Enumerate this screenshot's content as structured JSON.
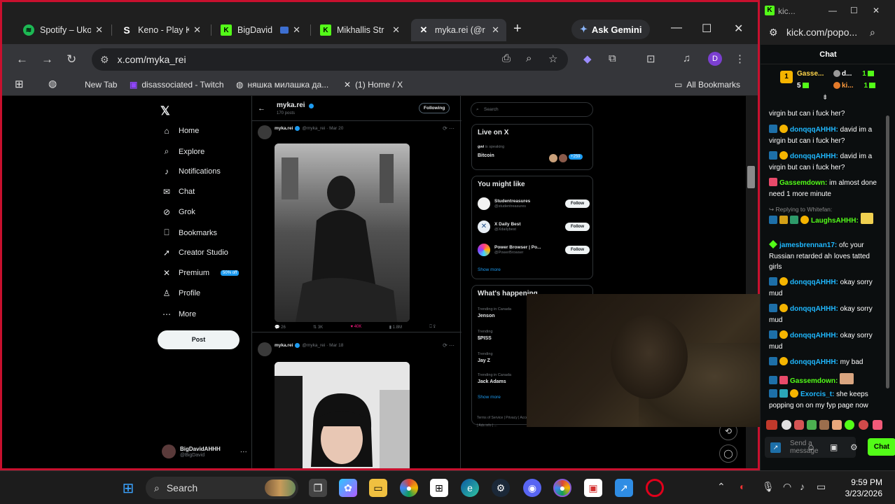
{
  "browser": {
    "tabs": [
      {
        "label": "Spotify – Uko",
        "icon": "spotify-icon",
        "color": "#1db954"
      },
      {
        "label": "Keno - Play K",
        "icon": "stake-icon",
        "color": "#ffffff"
      },
      {
        "label": "BigDavid",
        "icon": "kick-icon",
        "color": "#53fc18"
      },
      {
        "label": "Mikhallis Str",
        "icon": "kick-icon",
        "color": "#53fc18"
      },
      {
        "label": "myka.rei (@r",
        "icon": "x-icon",
        "color": "#ffffff"
      }
    ],
    "new_tab": "+",
    "gemini_label": "Ask Gemini",
    "url": "x.com/myka_rei",
    "profile_letter": "D",
    "bookmarks": [
      {
        "label": "New Tab"
      },
      {
        "label": "disassociated - Twitch"
      },
      {
        "label": "няшка милашка да..."
      },
      {
        "label": "(1) Home / X"
      }
    ],
    "all_bookmarks": "All Bookmarks"
  },
  "x": {
    "logo": "𝕏",
    "nav": [
      {
        "label": "Home",
        "icon": "home-icon",
        "glyph": "⌂"
      },
      {
        "label": "Explore",
        "icon": "search-icon",
        "glyph": "⌕"
      },
      {
        "label": "Notifications",
        "icon": "bell-icon",
        "glyph": "🔔"
      },
      {
        "label": "Chat",
        "icon": "mail-icon",
        "glyph": "✉"
      },
      {
        "label": "Grok",
        "icon": "grok-icon",
        "glyph": "⊘"
      },
      {
        "label": "Bookmarks",
        "icon": "bookmark-icon",
        "glyph": "⎕"
      },
      {
        "label": "Creator Studio",
        "icon": "rocket-icon",
        "glyph": "➚"
      },
      {
        "label": "Premium",
        "icon": "x-premium-icon",
        "glyph": "✕"
      },
      {
        "label": "Profile",
        "icon": "person-icon",
        "glyph": "♙"
      },
      {
        "label": "More",
        "icon": "more-icon",
        "glyph": "⋯"
      }
    ],
    "premium_badge": "50% off",
    "post_button": "Post",
    "account": {
      "name": "BigDavidAHHH",
      "handle": "@BigDavid",
      "more": "···"
    },
    "profile_header": {
      "name": "myka.rei",
      "posts": "170 posts",
      "following_button": "Following"
    },
    "tweets": [
      {
        "name": "myka.rei",
        "handle": "@myka_rei · Mar 20",
        "replies": "26",
        "reposts": "3K",
        "likes": "40K",
        "views": "1.8M"
      },
      {
        "name": "myka.rei",
        "handle": "@myka_rei · Mar 18"
      }
    ],
    "search_placeholder": "Search",
    "live": {
      "title": "Live on X",
      "host": "gwi",
      "status": "is speaking",
      "topic": "Bitcoin",
      "count": "+259"
    },
    "you_might_like": {
      "title": "You might like",
      "accounts": [
        {
          "name": "Studentreasures",
          "handle": "@studentreasures",
          "follow": "Follow"
        },
        {
          "name": "X Daily Best",
          "handle": "@Xdailybest",
          "follow": "Follow"
        },
        {
          "name": "Power Browser | Po...",
          "handle": "@PowerBrowser",
          "follow": "Follow"
        }
      ],
      "show_more": "Show more"
    },
    "happening": {
      "title": "What's happening",
      "trends": [
        {
          "context": "Trending in Canada",
          "name": "Jenson"
        },
        {
          "context": "Trending",
          "name": "$PISS"
        },
        {
          "context": "Trending",
          "name": "Jay Z"
        },
        {
          "context": "Trending in Canada",
          "name": "Jack Adams"
        }
      ],
      "show_more": "Show more",
      "footer": "Terms of Service | Privacy | Accessibility | Ads info | ..."
    }
  },
  "kick": {
    "title": "kic...",
    "url": "kick.com/popo...",
    "chat_title": "Chat",
    "gifters": [
      {
        "name": "Gasse...",
        "count": "5",
        "tier": "1"
      },
      {
        "name": "d...",
        "count": "1"
      },
      {
        "name": "ki...",
        "count": "1"
      }
    ],
    "messages": [
      {
        "user": "",
        "text": "virgin but can i fuck her?",
        "color": "#ffffff"
      },
      {
        "user": "donqqqAHHH:",
        "text": "david im a virgin but can i fuck her?",
        "color": "#1fb8ff"
      },
      {
        "user": "donqqqAHHH:",
        "text": "david im a virgin but can i fuck her?",
        "color": "#1fb8ff"
      },
      {
        "user": "Gassemdown:",
        "text": "im almost done need 1 more minute",
        "color": "#53fc18"
      },
      {
        "user": "LaughsAHHH:",
        "text": "",
        "color": "#53fc18"
      },
      {
        "user": "jamesbrennan17:",
        "text": "ofc your Russian retarded ah loves tatted girls",
        "color": "#1fb8ff"
      },
      {
        "user": "donqqqAHHH:",
        "text": "okay sorry mud",
        "color": "#1fb8ff"
      },
      {
        "user": "donqqqAHHH:",
        "text": "okay sorry mud",
        "color": "#1fb8ff"
      },
      {
        "user": "donqqqAHHH:",
        "text": "okay sorry mud",
        "color": "#1fb8ff"
      },
      {
        "user": "donqqqAHHH:",
        "text": "my bad",
        "color": "#1fb8ff"
      },
      {
        "user": "Gassemdown:",
        "text": "",
        "color": "#53fc18"
      },
      {
        "user": "Exorcis_t:",
        "text": "she keeps popping on on my fyp page now",
        "color": "#1fb8ff"
      }
    ],
    "reply_label": "Replying to Whitefan:",
    "input_placeholder": "Send a message",
    "chat_button": "Chat"
  },
  "taskbar": {
    "search_label": "Search",
    "time": "9:59 PM",
    "date": "3/23/2026"
  }
}
